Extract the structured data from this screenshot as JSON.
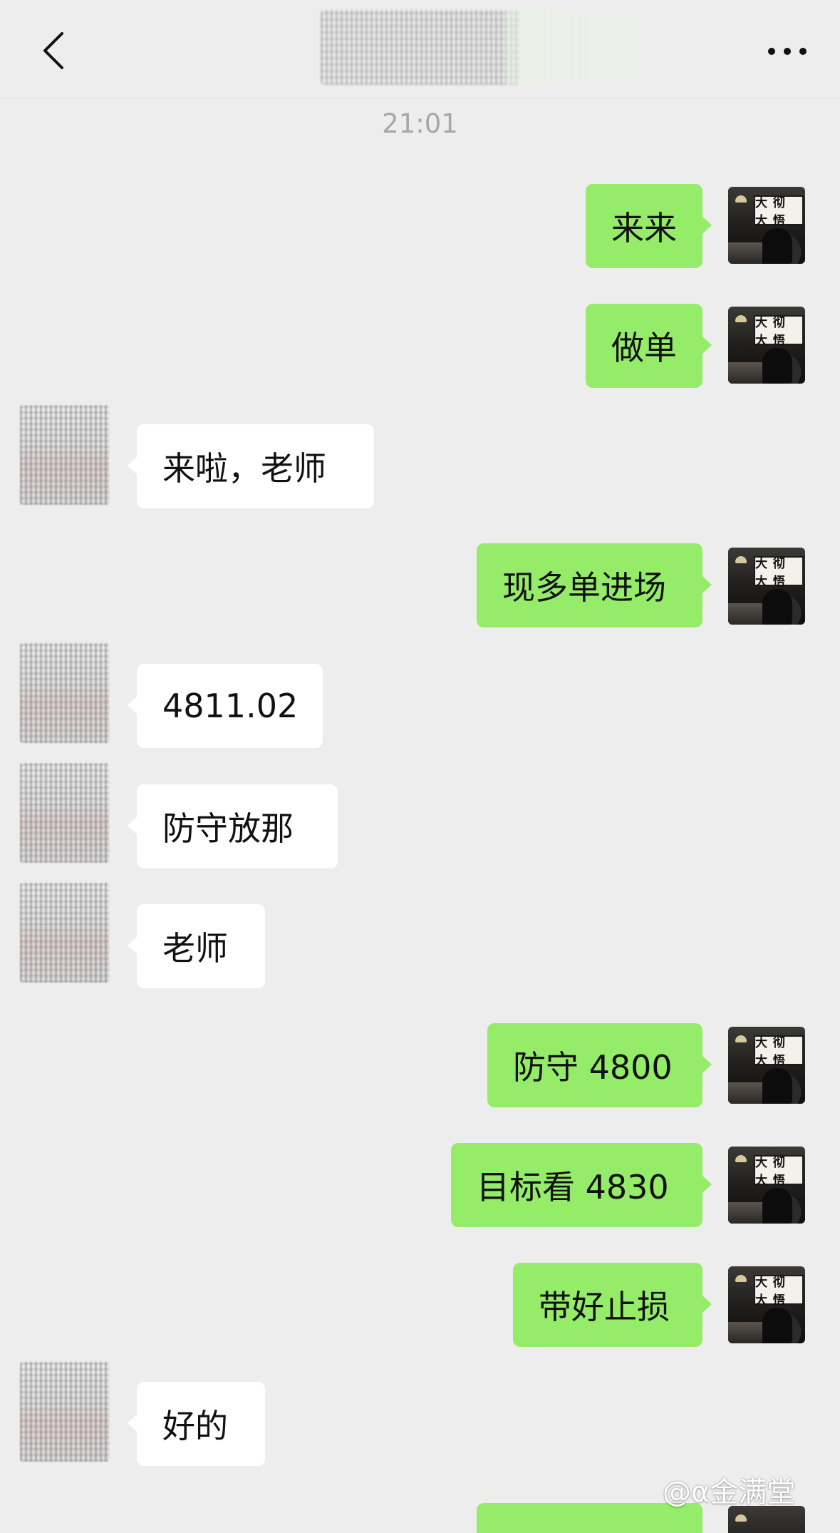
{
  "header": {
    "back_icon": "chevron-left-icon",
    "more_icon": "more-horizontal-icon"
  },
  "timestamp": "21:01",
  "self_avatar_sign": "大 彻 大 悟",
  "messages": [
    {
      "side": "right",
      "text": "来来"
    },
    {
      "side": "right",
      "text": "做单"
    },
    {
      "side": "left",
      "text": "来啦，老师"
    },
    {
      "side": "right",
      "text": "现多单进场"
    },
    {
      "side": "left",
      "text": "4811.02"
    },
    {
      "side": "left",
      "text": "防守放那"
    },
    {
      "side": "left",
      "text": "老师"
    },
    {
      "side": "right",
      "text": "防守 4800"
    },
    {
      "side": "right",
      "text": "目标看 4830"
    },
    {
      "side": "right",
      "text": "带好止损"
    },
    {
      "side": "left",
      "text": "好的"
    }
  ],
  "watermark": "@α金满堂",
  "colors": {
    "background": "#ededed",
    "self_bubble": "#95ec69",
    "other_bubble": "#ffffff",
    "timestamp": "#a7a7a7"
  }
}
